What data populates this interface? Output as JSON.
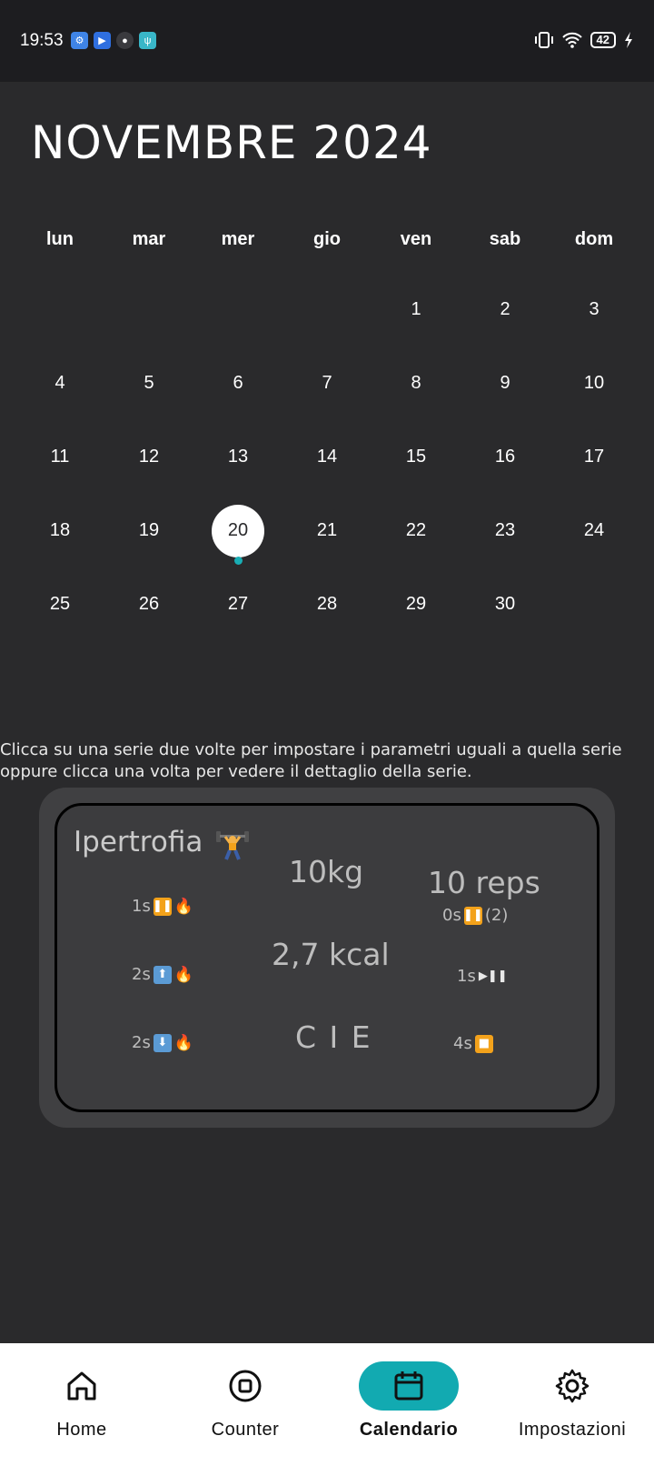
{
  "status_bar": {
    "time": "19:53",
    "battery": "42",
    "left_icons": [
      "settings-app-icon",
      "youtube-app-icon",
      "notes-app-icon",
      "usb-app-icon"
    ],
    "right_icons": [
      "vibrate-icon",
      "wifi-icon",
      "battery-icon",
      "charging-icon"
    ]
  },
  "calendar": {
    "month_title": "NOVEMBRE 2024",
    "weekdays": [
      "lun",
      "mar",
      "mer",
      "gio",
      "ven",
      "sab",
      "dom"
    ],
    "days": [
      "",
      "",
      "",
      "",
      "1",
      "2",
      "3",
      "4",
      "5",
      "6",
      "7",
      "8",
      "9",
      "10",
      "11",
      "12",
      "13",
      "14",
      "15",
      "16",
      "17",
      "18",
      "19",
      "20",
      "21",
      "22",
      "23",
      "24",
      "25",
      "26",
      "27",
      "28",
      "29",
      "30",
      ""
    ],
    "selected_day": "20",
    "event_dot_color": "#19aeb5"
  },
  "hint": "Clicca su una serie due volte per impostare i parametri uguali a quella serie oppure clicca una volta per vedere il dettaglio della serie.",
  "series_card": {
    "title": "Ipertrofia",
    "title_icon": "weightlifter-icon",
    "left_col": [
      {
        "time": "1s",
        "icon": "pause-icon",
        "fire": true
      },
      {
        "time": "2s",
        "icon": "up-arrow-icon",
        "fire": true
      },
      {
        "time": "2s",
        "icon": "down-arrow-icon",
        "fire": true
      }
    ],
    "weight": "10kg",
    "kcal": "2,7 kcal",
    "code": "C I E",
    "reps": "10 reps",
    "rest_sub": "0s",
    "rest_count": "(2)",
    "right_mid": "1s",
    "right_bottom": "4s"
  },
  "nav": {
    "items": [
      {
        "label": "Home",
        "icon": "home-icon"
      },
      {
        "label": "Counter",
        "icon": "counter-icon"
      },
      {
        "label": "Calendario",
        "icon": "calendar-icon"
      },
      {
        "label": "Impostazioni",
        "icon": "settings-icon"
      }
    ],
    "active": "Calendario",
    "accent": "#12aab1"
  }
}
